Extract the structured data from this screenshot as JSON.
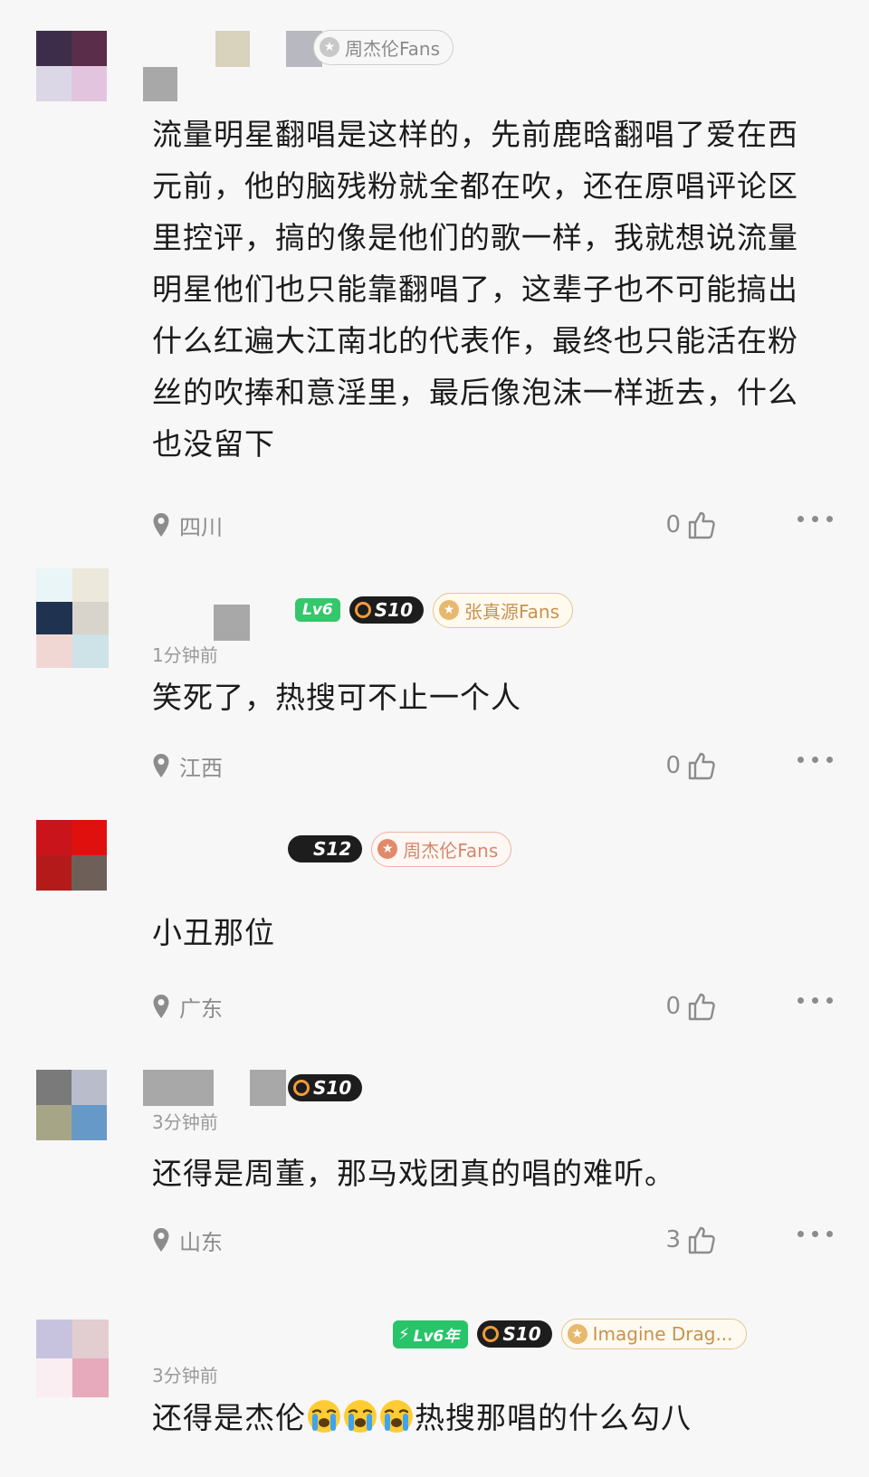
{
  "comments": [
    {
      "badges": {
        "fans": "周杰伦Fans"
      },
      "text": "流量明星翻唱是这样的，先前鹿晗翻唱了爱在西元前，他的脑残粉就全都在吹，还在原唱评论区里控评，搞的像是他们的歌一样，我就想说流量明星他们也只能靠翻唱了，这辈子也不可能搞出什么红遍大江南北的代表作，最终也只能活在粉丝的吹捧和意淫里，最后像泡沫一样逝去，什么也没留下",
      "location": "四川",
      "likes": "0"
    },
    {
      "badges": {
        "level": "Lv6",
        "s": "S10",
        "fans": "张真源Fans"
      },
      "time": "1分钟前",
      "text": "笑死了，热搜可不止一个人",
      "location": "江西",
      "likes": "0"
    },
    {
      "badges": {
        "s": "S12",
        "fans": "周杰伦Fans"
      },
      "text": "小丑那位",
      "location": "广东",
      "likes": "0"
    },
    {
      "badges": {
        "s": "S10"
      },
      "time": "3分钟前",
      "text": "还得是周董，那马戏团真的唱的难听。",
      "location": "山东",
      "likes": "3"
    },
    {
      "badges": {
        "level": "Lv6年",
        "s": "S10",
        "fans": "Imagine Drag..."
      },
      "time": "3分钟前",
      "text_before": "还得是杰伦",
      "text_after": "热搜那唱的什么勾八",
      "emoji": "crying-face"
    }
  ],
  "colors": {
    "level_green": "#35c76b",
    "fans_gold": "#c8924e",
    "meta_gray": "#8c8c8c",
    "background": "#f7f7f7"
  }
}
